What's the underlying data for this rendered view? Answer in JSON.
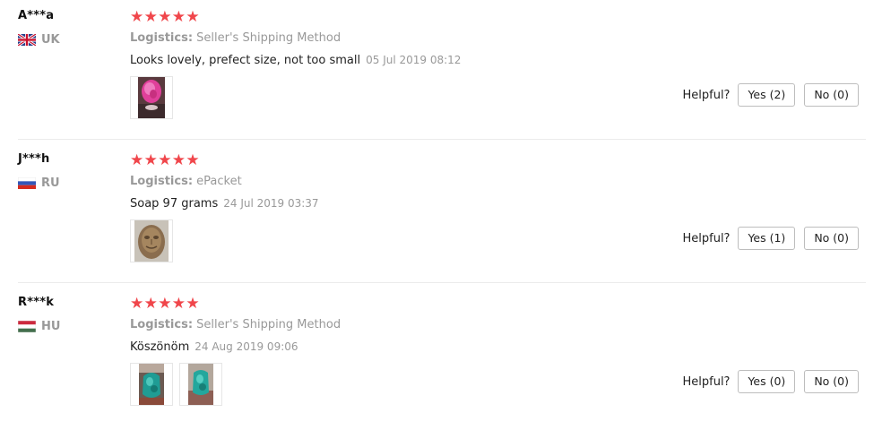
{
  "reviews": [
    {
      "buyer": "A***a",
      "country_code": "UK",
      "flag_icon": "gb-flag-icon",
      "stars": 5,
      "logistics_label": "Logistics:",
      "logistics_value": "Seller's Shipping Method",
      "feedback_text": "Looks lovely, prefect size, not too small",
      "date": "05 Jul 2019 08:12",
      "photo_icons": [
        "pink-soap-photo"
      ],
      "helpful_label": "Helpful?",
      "yes_label": "Yes (2)",
      "no_label": "No (0)"
    },
    {
      "buyer": "J***h",
      "country_code": "RU",
      "flag_icon": "ru-flag-icon",
      "stars": 5,
      "logistics_label": "Logistics:",
      "logistics_value": "ePacket",
      "feedback_text": "Soap 97 grams",
      "date": "24 Jul 2019 03:37",
      "photo_icons": [
        "brown-soap-photo"
      ],
      "helpful_label": "Helpful?",
      "yes_label": "Yes (1)",
      "no_label": "No (0)"
    },
    {
      "buyer": "R***k",
      "country_code": "HU",
      "flag_icon": "hu-flag-icon",
      "stars": 5,
      "logistics_label": "Logistics:",
      "logistics_value": "Seller's Shipping Method",
      "feedback_text": "Köszönöm",
      "date": "24 Aug 2019 09:06",
      "photo_icons": [
        "teal-soap-photo",
        "teal-soap-photo"
      ],
      "helpful_label": "Helpful?",
      "yes_label": "Yes (0)",
      "no_label": "No (0)"
    }
  ],
  "colors": {
    "star": "#f0464b",
    "muted_text": "#999999",
    "divider": "#ebebeb",
    "button_border": "#bdbdbd"
  }
}
